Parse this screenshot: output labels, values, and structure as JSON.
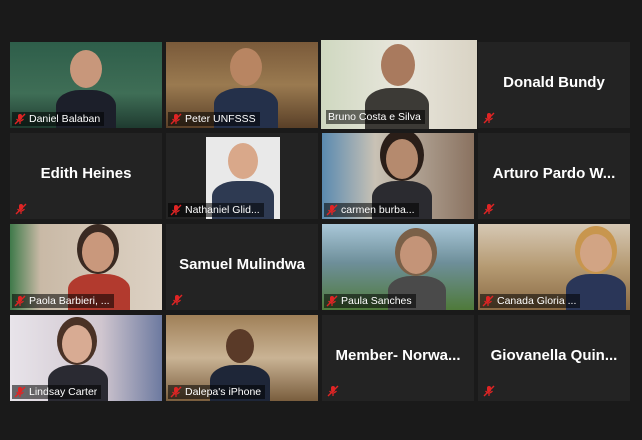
{
  "participants": [
    {
      "name": "Daniel Balaban",
      "video": true
    },
    {
      "name": "Peter UNFSSS",
      "video": true
    },
    {
      "name": "Bruno Costa e Silva",
      "video": true,
      "active_speaker": true
    },
    {
      "name": "Donald Bundy",
      "video": false
    },
    {
      "name": "Edith Heines",
      "video": false
    },
    {
      "name": "Nathaniel Glid...",
      "video": true
    },
    {
      "name": "carmen burba...",
      "video": true
    },
    {
      "name": "Arturo Pardo W...",
      "video": false
    },
    {
      "name": "Paola Barbieri, ...",
      "video": true
    },
    {
      "name": "Samuel Mulindwa",
      "video": false
    },
    {
      "name": "Paula Sanches",
      "video": true
    },
    {
      "name": "Canada Gloria ...",
      "video": true
    },
    {
      "name": "Lindsay Carter",
      "video": true
    },
    {
      "name": "Dalepa's iPhone",
      "video": true
    },
    {
      "name": "Member- Norwa...",
      "video": false
    },
    {
      "name": "Giovanella Quin...",
      "video": false
    }
  ],
  "colors": {
    "active_border": "#c7e04a",
    "muted_icon": "#e02424",
    "tile_bg": "#232323"
  },
  "icons": {
    "muted": "microphone-muted-icon"
  }
}
